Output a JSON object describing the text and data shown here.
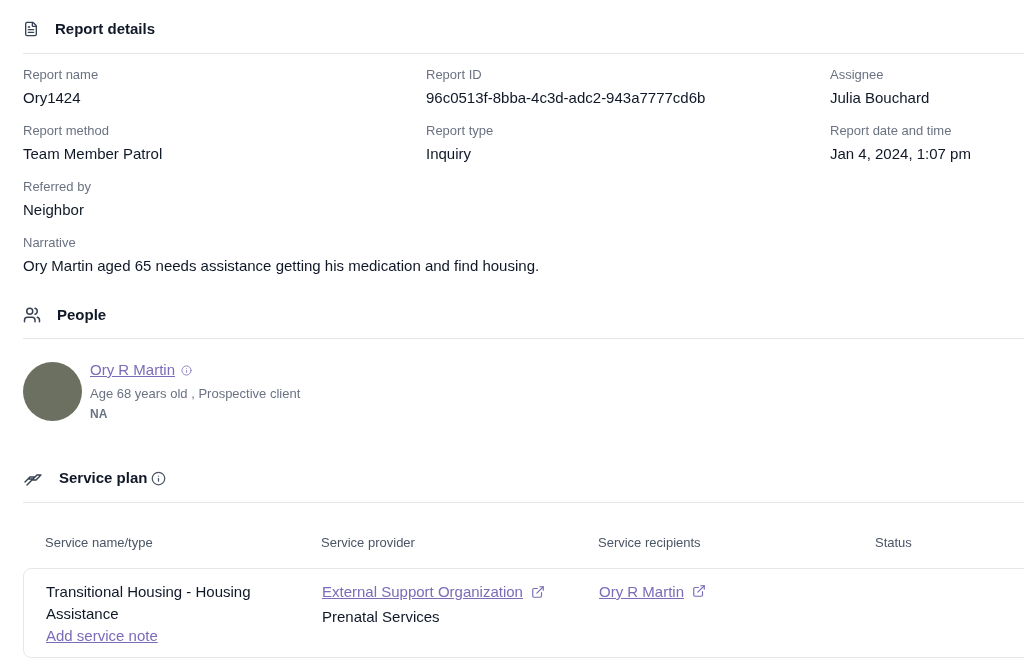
{
  "report_details": {
    "title": "Report details",
    "fields": [
      {
        "label": "Report name",
        "value": "Ory1424"
      },
      {
        "label": "Report ID",
        "value": "96c0513f-8bba-4c3d-adc2-943a7777cd6b"
      },
      {
        "label": "Assignee",
        "value": "Julia Bouchard"
      },
      {
        "label": "Report method",
        "value": "Team Member Patrol"
      },
      {
        "label": "Report type",
        "value": "Inquiry"
      },
      {
        "label": "Report date and time",
        "value": "Jan 4, 2024, 1:07 pm"
      },
      {
        "label": "Referred by",
        "value": "Neighbor"
      }
    ],
    "narrative": {
      "label": "Narrative",
      "value": "Ory Martin aged 65 needs assistance getting his medication and find housing."
    }
  },
  "people": {
    "title": "People",
    "persons": [
      {
        "name": "Ory R Martin",
        "details": "Age 68 years old , Prospective client",
        "note": "NA"
      }
    ]
  },
  "service_plan": {
    "title": "Service plan",
    "columns": [
      "Service name/type",
      "Service provider",
      "Service recipients",
      "Status"
    ],
    "rows": [
      {
        "service": "Transitional Housing - Housing Assistance",
        "action": "Add service note",
        "provider": "External Support Organization",
        "provider_type": "Prenatal Services",
        "recipient": "Ory R Martin"
      }
    ]
  }
}
